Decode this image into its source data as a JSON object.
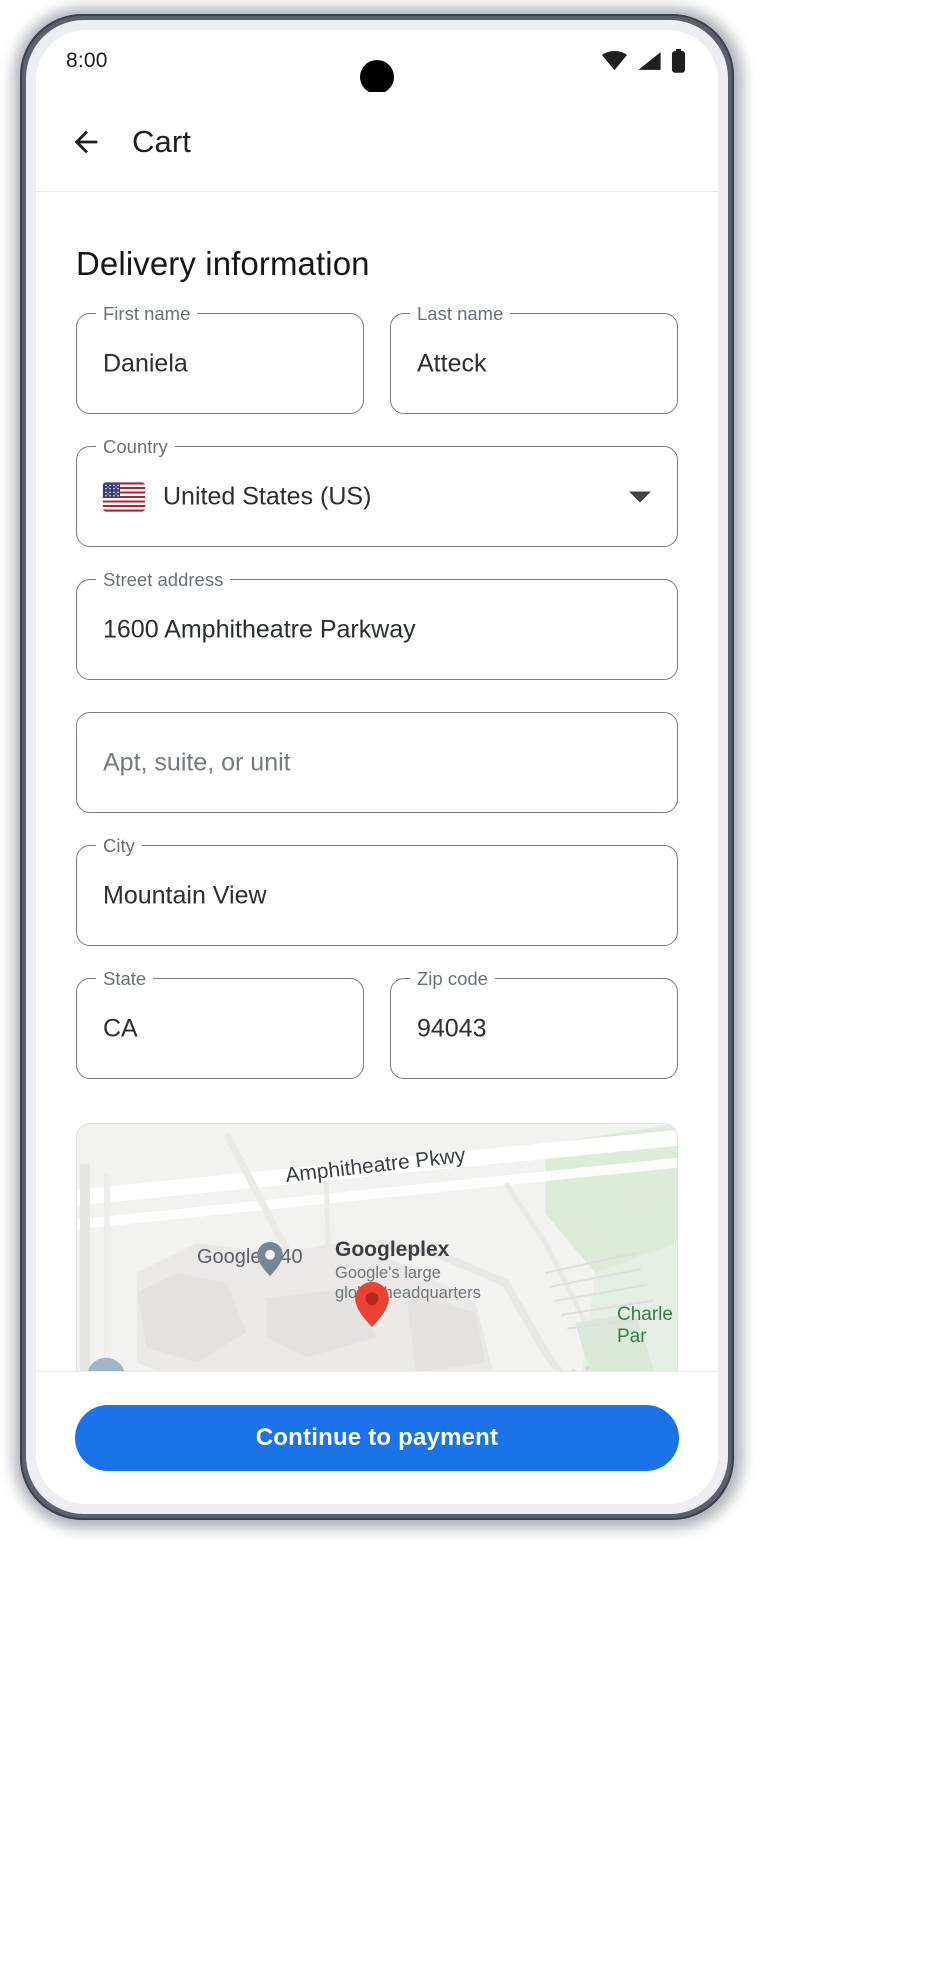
{
  "status_bar": {
    "time": "8:00",
    "icons": [
      "wifi-icon",
      "signal-icon",
      "battery-icon"
    ]
  },
  "app_bar": {
    "back_icon": "arrow-back-icon",
    "title": "Cart"
  },
  "section": {
    "heading": "Delivery information"
  },
  "form": {
    "first_name": {
      "label": "First name",
      "value": "Daniela"
    },
    "last_name": {
      "label": "Last name",
      "value": "Atteck"
    },
    "country": {
      "label": "Country",
      "value": "United States (US)",
      "flag": "us-flag-icon",
      "caret": "chevron-down-icon"
    },
    "street_address": {
      "label": "Street address",
      "value": "1600 Amphitheatre Parkway"
    },
    "apt": {
      "label": "",
      "placeholder": "Apt, suite, or unit",
      "value": ""
    },
    "city": {
      "label": "City",
      "value": "Mountain View"
    },
    "state": {
      "label": "State",
      "value": "CA"
    },
    "zip": {
      "label": "Zip code",
      "value": "94043"
    }
  },
  "map": {
    "street_label": "Amphitheatre Pkwy",
    "building_label": "Google B40",
    "poi_name": "Googleplex",
    "poi_desc_line1": "Google's large",
    "poi_desc_line2": "global headquarters",
    "park_line1": "Charle",
    "park_line2": "Par",
    "marker_primary": "location-pin-icon",
    "marker_secondary": "place-pin-icon"
  },
  "bottom_bar": {
    "cta_label": "Continue to payment"
  },
  "colors": {
    "accent": "#1a73e8",
    "field_border": "#777c84",
    "label_text": "#6b7078",
    "value_text": "#2b2e33",
    "marker_red": "#ea4335"
  }
}
